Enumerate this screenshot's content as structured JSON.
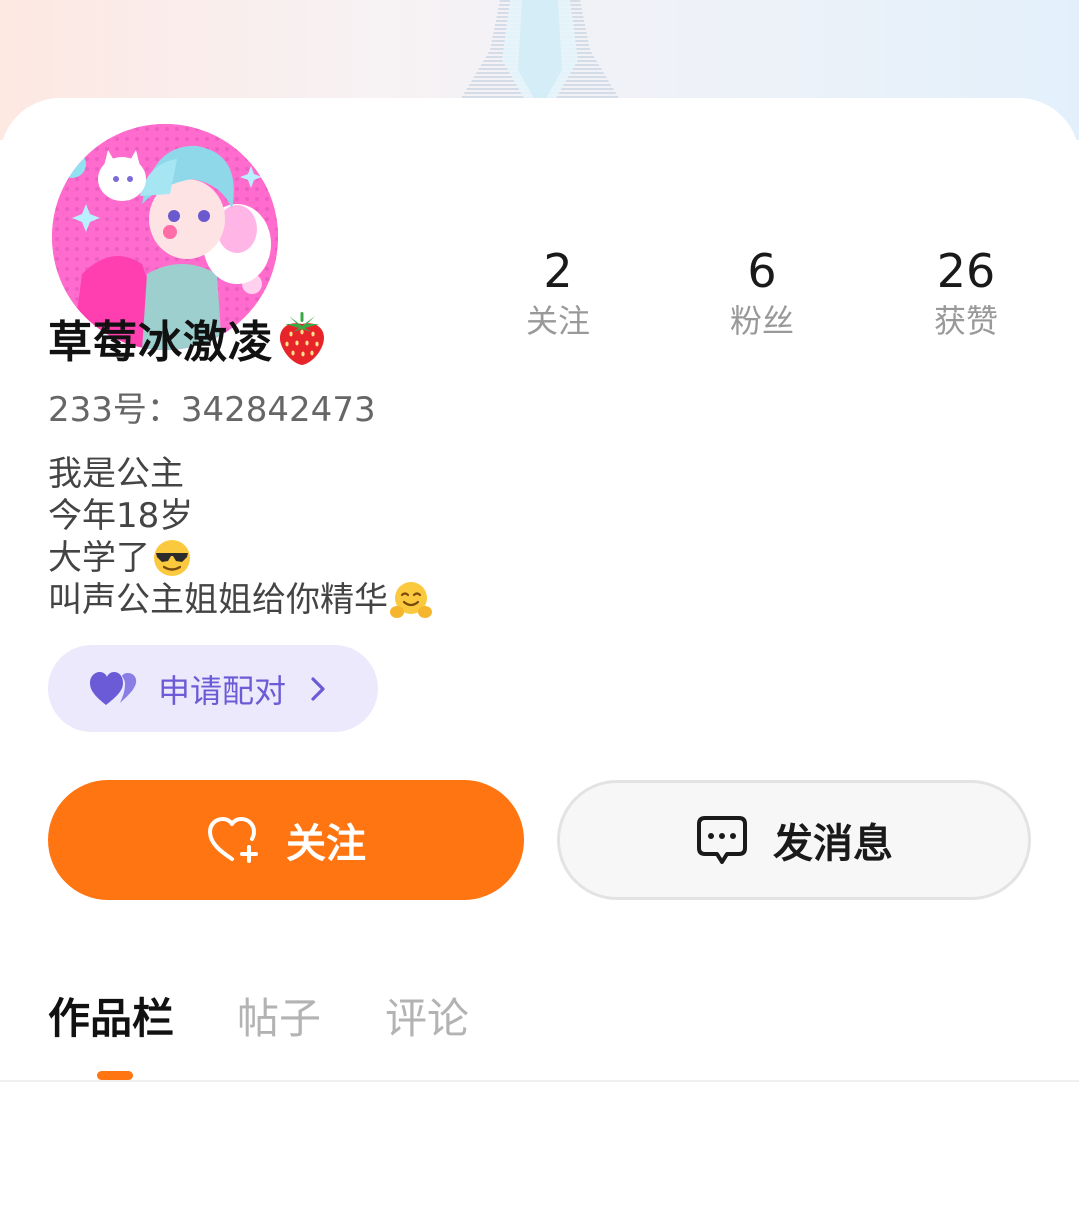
{
  "profile": {
    "username": "草莓冰激凌",
    "username_emoji": "🍓",
    "uid": "233号：342842473",
    "bio": [
      {
        "text": "我是公主",
        "emoji": ""
      },
      {
        "text": "今年18岁",
        "emoji": ""
      },
      {
        "text": "大学了",
        "emoji": "😎"
      },
      {
        "text": "叫声公主姐姐给你精华",
        "emoji": "🤗"
      }
    ]
  },
  "stats": [
    {
      "value": "2",
      "label": "关注"
    },
    {
      "value": "6",
      "label": "粉丝"
    },
    {
      "value": "26",
      "label": "获赞"
    }
  ],
  "pair_button": {
    "label": "申请配对",
    "icon": "purple-hearts-icon"
  },
  "actions": {
    "follow_label": "关注",
    "follow_icon": "heart-plus-icon",
    "message_label": "发消息",
    "message_icon": "chat-bubble-icon"
  },
  "tabs": [
    {
      "label": "作品栏",
      "active": true
    },
    {
      "label": "帖子",
      "active": false
    },
    {
      "label": "评论",
      "active": false
    }
  ],
  "colors": {
    "accent": "#ff7512",
    "pair_bg": "#ebe9fb",
    "pair_text": "#6b5bd6",
    "muted_text": "#999999"
  }
}
